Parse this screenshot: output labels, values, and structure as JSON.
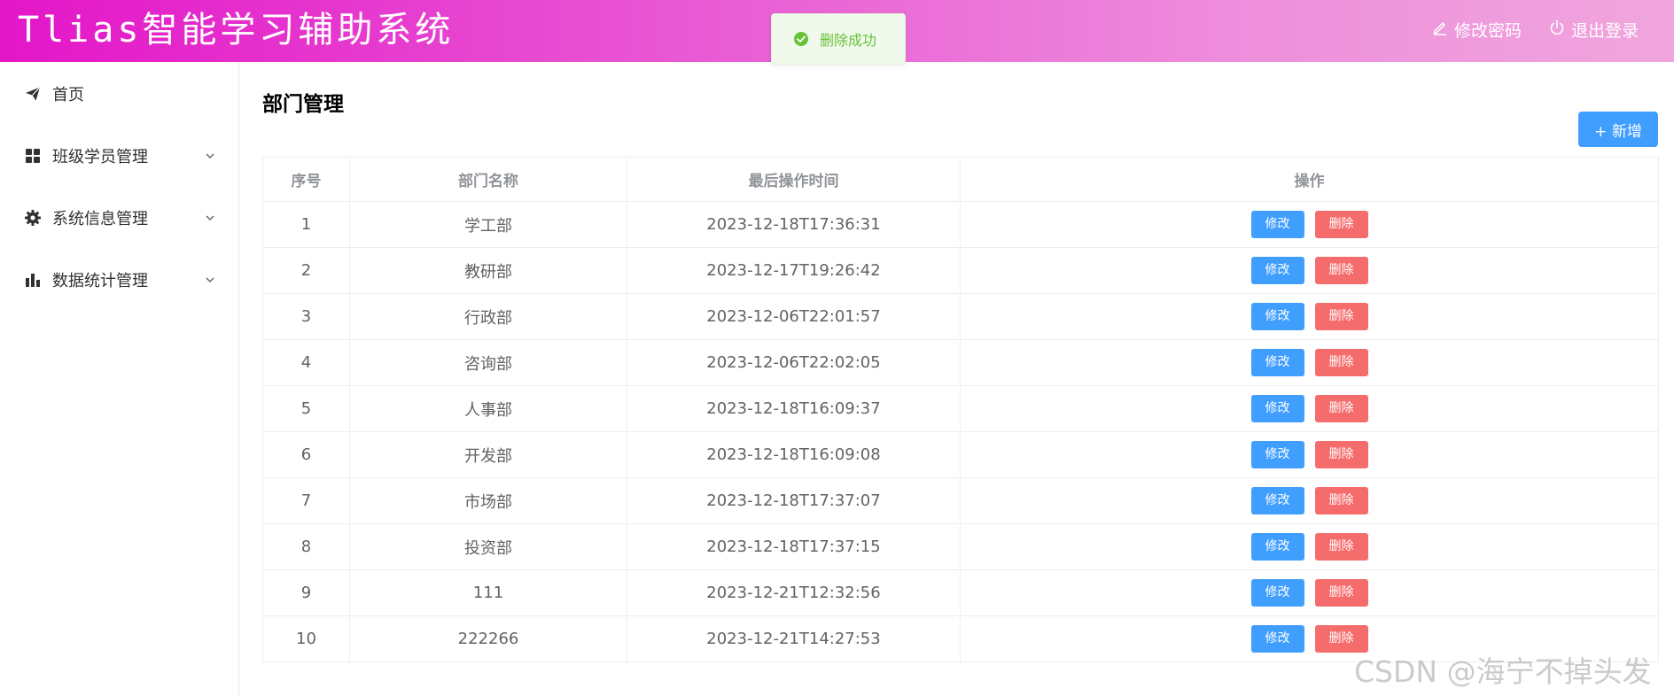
{
  "header": {
    "title": "Tlias智能学习辅助系统",
    "change_password": "修改密码",
    "logout": "退出登录"
  },
  "toast": {
    "message": "删除成功"
  },
  "sidebar": {
    "items": [
      {
        "label": "首页",
        "icon": "paper-plane-icon",
        "expandable": false
      },
      {
        "label": "班级学员管理",
        "icon": "grid-icon",
        "expandable": true
      },
      {
        "label": "系统信息管理",
        "icon": "gear-icon",
        "expandable": true
      },
      {
        "label": "数据统计管理",
        "icon": "bar-chart-icon",
        "expandable": true
      }
    ]
  },
  "main": {
    "title": "部门管理",
    "add_button": "+ 新增",
    "table": {
      "columns": [
        "序号",
        "部门名称",
        "最后操作时间",
        "操作"
      ],
      "edit_label": "修改",
      "delete_label": "删除",
      "rows": [
        {
          "index": "1",
          "name": "学工部",
          "time": "2023-12-18T17:36:31"
        },
        {
          "index": "2",
          "name": "教研部",
          "time": "2023-12-17T19:26:42"
        },
        {
          "index": "3",
          "name": "行政部",
          "time": "2023-12-06T22:01:57"
        },
        {
          "index": "4",
          "name": "咨询部",
          "time": "2023-12-06T22:02:05"
        },
        {
          "index": "5",
          "name": "人事部",
          "time": "2023-12-18T16:09:37"
        },
        {
          "index": "6",
          "name": "开发部",
          "time": "2023-12-18T16:09:08"
        },
        {
          "index": "7",
          "name": "市场部",
          "time": "2023-12-18T17:37:07"
        },
        {
          "index": "8",
          "name": "投资部",
          "time": "2023-12-18T17:37:15"
        },
        {
          "index": "9",
          "name": "111",
          "time": "2023-12-21T12:32:56"
        },
        {
          "index": "10",
          "name": "222266",
          "time": "2023-12-21T14:27:53"
        }
      ]
    }
  },
  "watermark": "CSDN @海宁不掉头发",
  "colors": {
    "primary": "#409eff",
    "danger": "#f56c6c",
    "success": "#67c23a",
    "header_start": "#e316c8",
    "header_end": "#f0a6dd"
  }
}
